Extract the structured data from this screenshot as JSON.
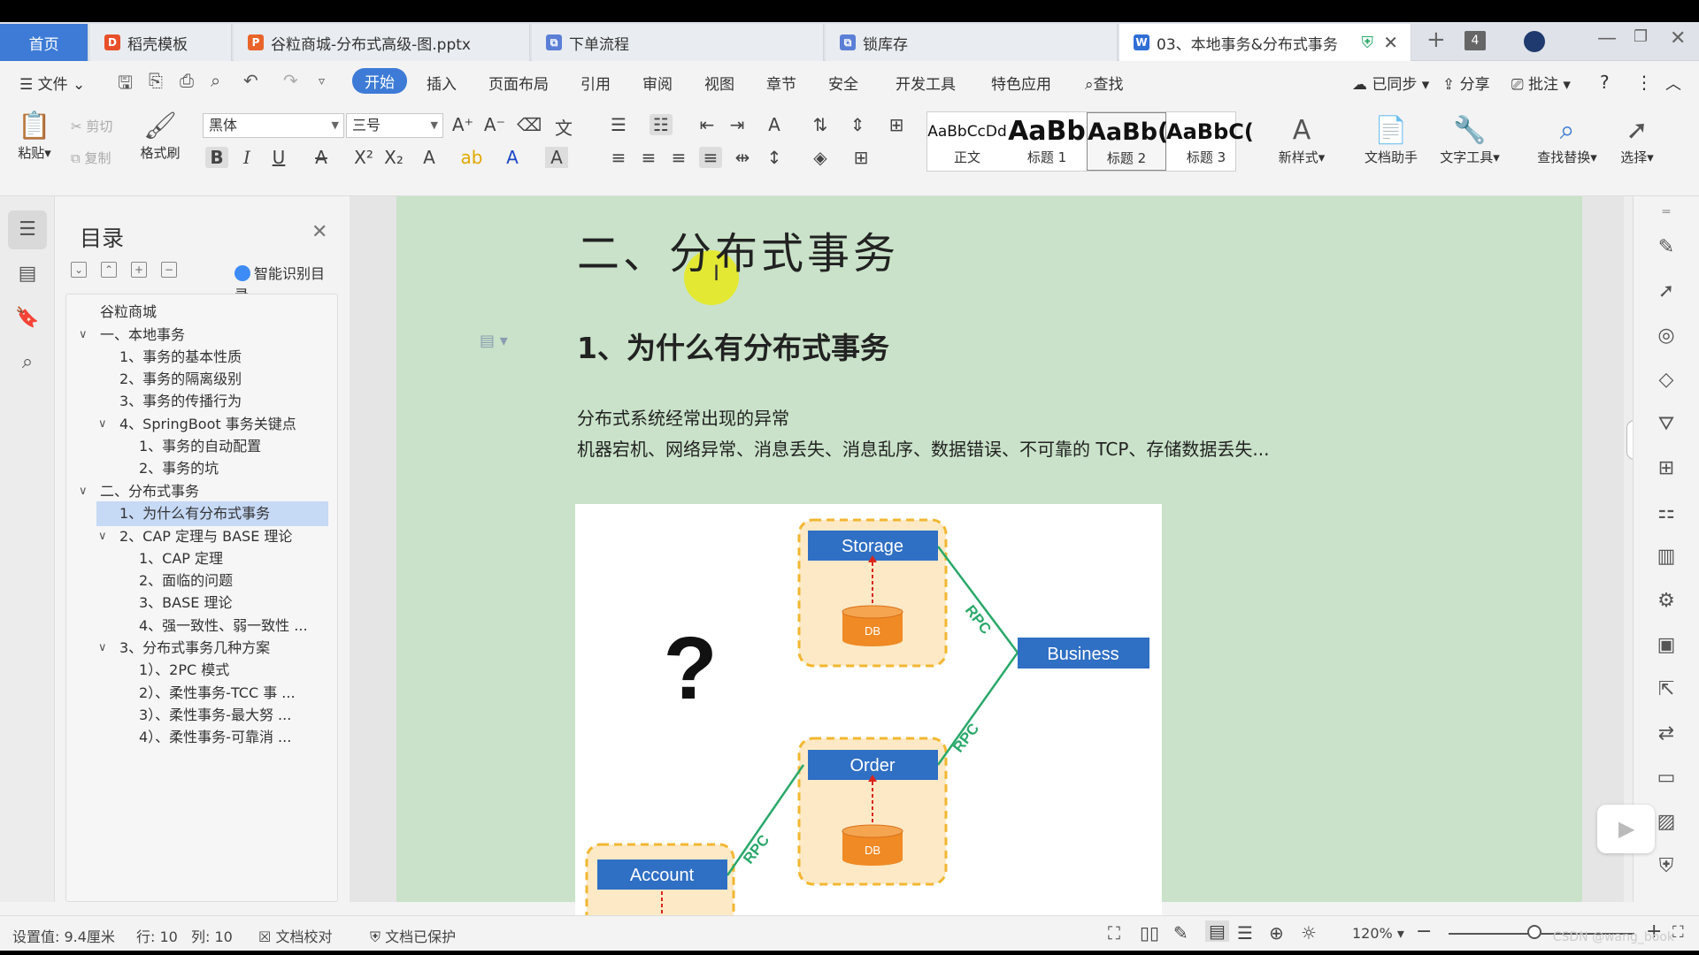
{
  "tabs": [
    {
      "label": "首页"
    },
    {
      "label": "稻壳模板"
    },
    {
      "label": "谷粒商城-分布式高级-图.pptx"
    },
    {
      "label": "下单流程"
    },
    {
      "label": "锁库存"
    },
    {
      "label": "03、本地事务&分布式事务"
    }
  ],
  "tab_count": "4",
  "menu": {
    "file": "文件",
    "items": [
      "开始",
      "插入",
      "页面布局",
      "引用",
      "审阅",
      "视图",
      "章节",
      "安全",
      "开发工具",
      "特色应用"
    ],
    "search": "查找",
    "synced": "已同步",
    "share": "分享",
    "comment": "批注"
  },
  "ribbon": {
    "paste": "粘贴",
    "cut": "剪切",
    "copy": "复制",
    "format_painter": "格式刷",
    "font": "黑体",
    "size": "三号",
    "styles": [
      {
        "preview": "AaBbCcDd",
        "label": "正文"
      },
      {
        "preview": "AaBb",
        "label": "标题 1"
      },
      {
        "preview": "AaBb(",
        "label": "标题 2"
      },
      {
        "preview": "AaBbC(",
        "label": "标题 3"
      }
    ],
    "new_style": "新样式",
    "doc_helper": "文档助手",
    "text_tools": "文字工具",
    "find_replace": "查找替换",
    "select": "选择"
  },
  "toc": {
    "title": "目录",
    "smart": "智能识别目录",
    "items": [
      {
        "text": "谷粒商城",
        "level": 0
      },
      {
        "text": "一、本地事务",
        "level": 1
      },
      {
        "text": "1、事务的基本性质",
        "level": 2
      },
      {
        "text": "2、事务的隔离级别",
        "level": 2
      },
      {
        "text": "3、事务的传播行为",
        "level": 2
      },
      {
        "text": "4、SpringBoot 事务关键点",
        "level": 2
      },
      {
        "text": "1、事务的自动配置",
        "level": 3
      },
      {
        "text": "2、事务的坑",
        "level": 3
      },
      {
        "text": "二、分布式事务",
        "level": 1
      },
      {
        "text": "1、为什么有分布式事务",
        "level": 2
      },
      {
        "text": "2、CAP 定理与 BASE 理论",
        "level": 2
      },
      {
        "text": "1、CAP 定理",
        "level": 3
      },
      {
        "text": "2、面临的问题",
        "level": 3
      },
      {
        "text": "3、BASE 理论",
        "level": 3
      },
      {
        "text": "4、强一致性、弱一致性 ...",
        "level": 3
      },
      {
        "text": "3、分布式事务几种方案",
        "level": 2
      },
      {
        "text": "1）、2PC 模式",
        "level": 3
      },
      {
        "text": "2）、柔性事务-TCC 事 ...",
        "level": 3
      },
      {
        "text": "3）、柔性事务-最大努 ...",
        "level": 3
      },
      {
        "text": "4）、柔性事务-可靠消 ...",
        "level": 3
      }
    ]
  },
  "doc": {
    "h1": "二、分布式事务",
    "h2": "1、为什么有分布式事务",
    "p1": "分布式系统经常出现的异常",
    "p2": "机器宕机、网络异常、消息丢失、消息乱序、数据错误、不可靠的 TCP、存储数据丢失..."
  },
  "diagram": {
    "storage": "Storage",
    "business": "Business",
    "order": "Order",
    "account": "Account",
    "db": "DB",
    "rpc": "RPC",
    "question": "?"
  },
  "status": {
    "setting": "设置值: 9.4厘米",
    "row": "行: 10",
    "col": "列: 10",
    "proof": "文档校对",
    "protected": "文档已保护",
    "zoom": "120%"
  },
  "watermark": "CSDN @wang_book",
  "colors": {
    "accent": "#3d7bd6",
    "page_bg": "#c9e2c9",
    "highlight": "#c6d9f5",
    "diagram_box": "#2f6fc4",
    "db": "#f08a24",
    "rpc": "#2aa86a"
  }
}
